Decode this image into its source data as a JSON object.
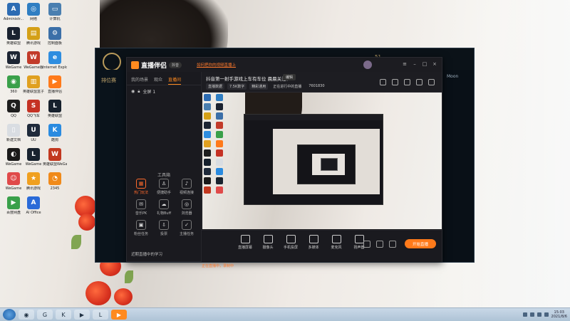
{
  "desktop": {
    "icons": [
      {
        "label": "Administr...",
        "glyph": "A",
        "color": "#2d6cb3"
      },
      {
        "label": "网络",
        "glyph": "◎",
        "color": "#2f7ec2"
      },
      {
        "label": "计算机",
        "glyph": "▭",
        "color": "#4a7fb0"
      },
      {
        "label": "英雄联盟",
        "glyph": "L",
        "color": "#1a2230"
      },
      {
        "label": "腾讯游戏",
        "glyph": "▤",
        "color": "#d4a017"
      },
      {
        "label": "控制面板",
        "glyph": "⚙",
        "color": "#3b6fa8"
      },
      {
        "label": "WeGame",
        "glyph": "W",
        "color": "#1d2533"
      },
      {
        "label": "WeGame版",
        "glyph": "W",
        "color": "#c23b2a"
      },
      {
        "label": "Internet Explorer",
        "glyph": "e",
        "color": "#2e8de0"
      },
      {
        "label": "360",
        "glyph": "◉",
        "color": "#3aa04a"
      },
      {
        "label": "英雄联盟盒子",
        "glyph": "▥",
        "color": "#e0a020"
      },
      {
        "label": "直播伴侣",
        "glyph": "▶",
        "color": "#ff7a1a"
      },
      {
        "label": "QQ",
        "glyph": "Q",
        "color": "#1e1e1e"
      },
      {
        "label": "QQ飞车",
        "glyph": "S",
        "color": "#c53224"
      },
      {
        "label": "英雄联盟",
        "glyph": "L",
        "color": "#16202c"
      },
      {
        "label": "新建文档",
        "glyph": "▯",
        "color": "#d9dde2"
      },
      {
        "label": "UU",
        "glyph": "U",
        "color": "#1f2a3a"
      },
      {
        "label": "酷狗",
        "glyph": "K",
        "color": "#2a8be0"
      },
      {
        "label": "WeGame",
        "glyph": "◐",
        "color": "#1a1a1a"
      },
      {
        "label": "WeGame",
        "glyph": "L",
        "color": "#18222e"
      },
      {
        "label": "英雄联盟WeGame版",
        "glyph": "W",
        "color": "#c2381f"
      },
      {
        "label": "WeGame",
        "glyph": "☺",
        "color": "#e04a4a"
      },
      {
        "label": "腾讯游戏",
        "glyph": "★",
        "color": "#f0a020"
      },
      {
        "label": "2345",
        "glyph": "◔",
        "color": "#f08a1a"
      },
      {
        "label": "百度网盘",
        "glyph": "▶",
        "color": "#39a04a"
      },
      {
        "label": "AI Office",
        "glyph": "A",
        "color": "#2a6ad8"
      }
    ]
  },
  "lol": {
    "side_label": "排位赛",
    "right_label": "Moon",
    "coins": "51"
  },
  "app": {
    "brand": "直播伴侣",
    "badge": "抖音",
    "notice": "如何把你的视频直播上",
    "tabs": [
      "我的场景",
      "观众",
      "直播间"
    ],
    "active_tab": "直播间",
    "scene_label": "全屏 1",
    "tools_title": "工具箱",
    "tools": [
      {
        "icon": "▦",
        "label": "热门玩法",
        "hot": true
      },
      {
        "icon": "♙",
        "label": "便捷助手",
        "hot": false
      },
      {
        "icon": "♪",
        "label": "视频连接",
        "hot": false
      },
      {
        "icon": "✉",
        "label": "音乐PK",
        "hot": false
      },
      {
        "icon": "☁",
        "label": "礼物Buff",
        "hot": false
      },
      {
        "icon": "◎",
        "label": "浏览器",
        "hot": false
      },
      {
        "icon": "▣",
        "label": "粉丝任务",
        "hot": false
      },
      {
        "icon": "⇩",
        "label": "投票",
        "hot": false
      },
      {
        "icon": "✓",
        "label": "主播任务",
        "hot": false
      }
    ],
    "bottom_note": "近期直播中的学习",
    "room_title": "抖音第一射手游戏上车有车位 晨晨关注！",
    "room_edit": "编辑",
    "meta": [
      "直播数据",
      "7.5K数字",
      "精彩通用",
      "正在进行中的直播",
      "7601830"
    ],
    "controls": [
      {
        "icon": "display-icon",
        "label": "直播屏幕"
      },
      {
        "icon": "camera-icon",
        "label": "摄像头"
      },
      {
        "icon": "phone-icon",
        "label": "手机投屏"
      },
      {
        "icon": "media-icon",
        "label": "多媒体"
      },
      {
        "icon": "mic-icon",
        "label": "麦克风"
      },
      {
        "icon": "speaker-icon",
        "label": "扬声器"
      }
    ],
    "go_live": "开始直播",
    "status_line": "正在直播中，录制中"
  },
  "taskbar": {
    "time": "15:03",
    "date": "2021/8/6"
  },
  "colors": {
    "accent": "#ff7a1a"
  }
}
